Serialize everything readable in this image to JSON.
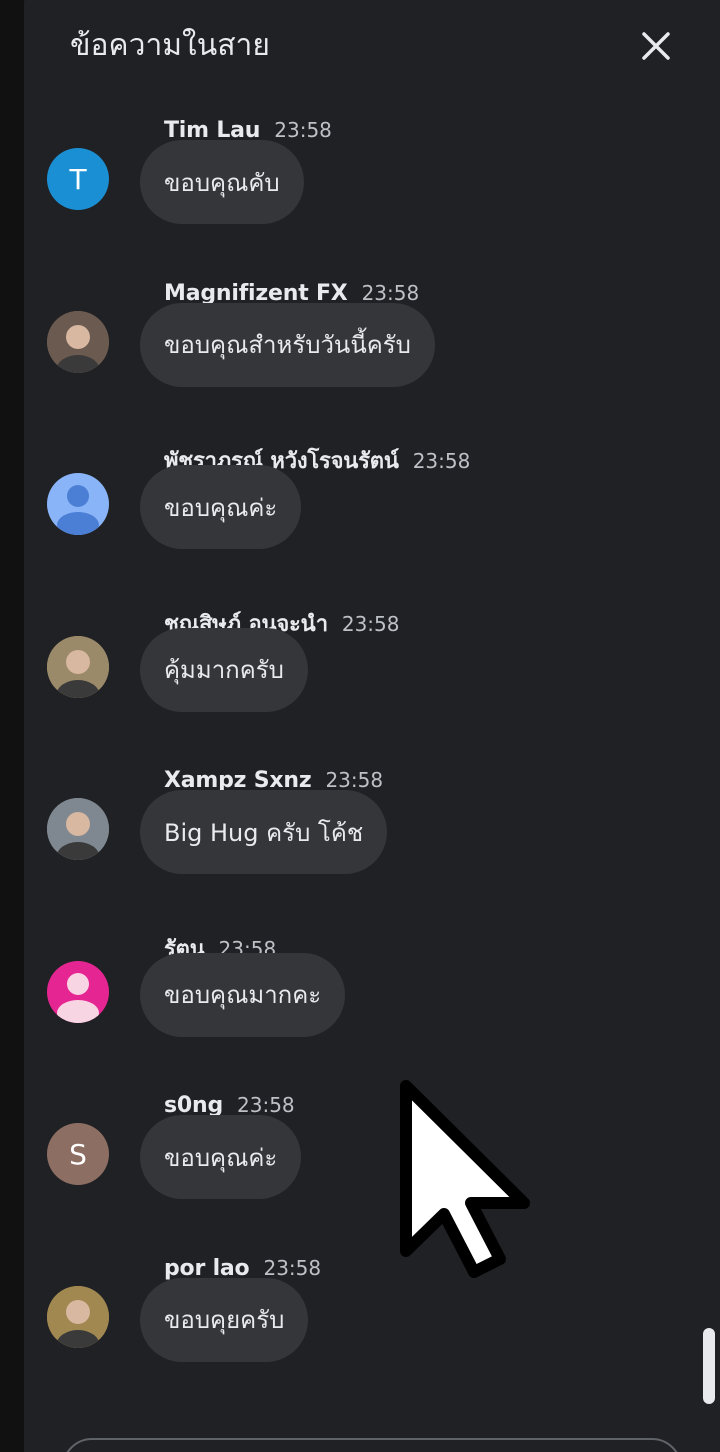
{
  "header": {
    "title": "ข้อความในสาย",
    "close_icon": "close-icon"
  },
  "messages": [
    {
      "author": "Tim Lau",
      "time": "23:58",
      "text": "ขอบคุณคับ",
      "avatar": {
        "type": "initial",
        "initial": "T",
        "color": "#1a8fd4"
      }
    },
    {
      "author": "Magnifizent FX",
      "time": "23:58",
      "text": "ขอบคุณสำหรับวันนี้ครับ",
      "avatar": {
        "type": "photo",
        "icon": "portrait-photo",
        "color": "#6a5a50"
      }
    },
    {
      "author": "พัชราภรณ์ หวังโรจนรัตน์",
      "time": "23:58",
      "text": "ขอบคุณค่ะ",
      "avatar": {
        "type": "default",
        "icon": "person-icon",
        "color": "#8ab4f8"
      }
    },
    {
      "author": "ชณสิษฎ์ อุนจะนำ",
      "time": "23:58",
      "text": "คุ้มมากครับ",
      "avatar": {
        "type": "photo",
        "icon": "portrait-photo",
        "color": "#9a8a6a"
      }
    },
    {
      "author": "Xampz Sxnz",
      "time": "23:58",
      "text": "Big Hug ครับ โค้ช",
      "avatar": {
        "type": "photo",
        "icon": "portrait-photo",
        "color": "#7f8790"
      }
    },
    {
      "author": "รัตน",
      "time": "23:58",
      "text": "ขอบคุณมากคะ",
      "avatar": {
        "type": "default",
        "icon": "person-icon",
        "color": "#e52592"
      }
    },
    {
      "author": "s0ng",
      "time": "23:58",
      "text": "ขอบคุณค่ะ",
      "avatar": {
        "type": "initial",
        "initial": "S",
        "color": "#8d6e63"
      }
    },
    {
      "author": "por lao",
      "time": "23:58",
      "text": "ขอบคุยครับ",
      "avatar": {
        "type": "photo",
        "icon": "portrait-photo",
        "color": "#a08850"
      }
    }
  ],
  "cursor_icon": "mouse-pointer-icon"
}
